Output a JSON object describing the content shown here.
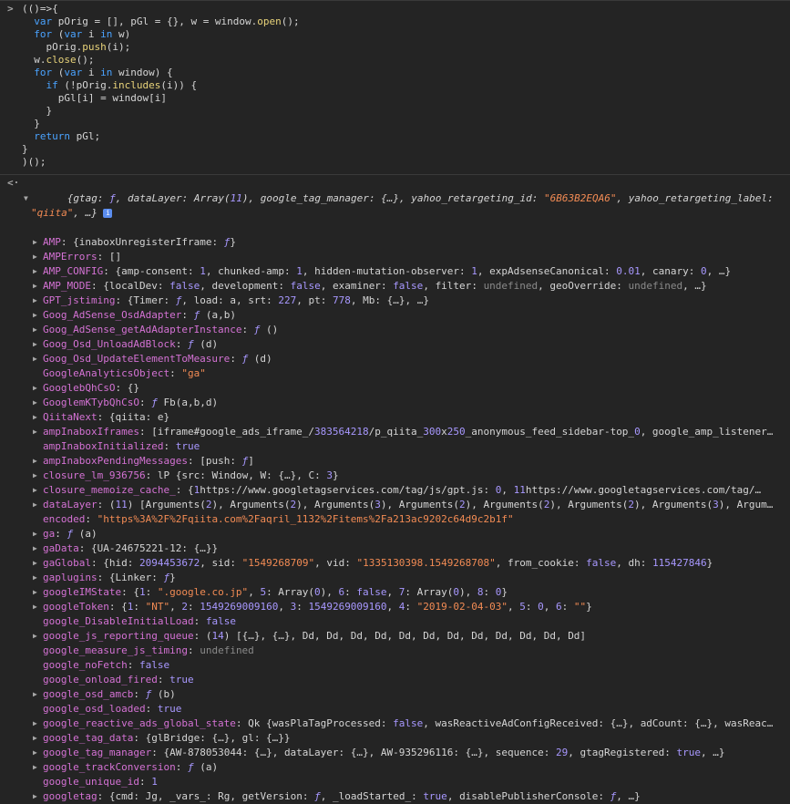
{
  "code_lines": [
    "(()=>{",
    "  var pOrig = [], pGl = {}, w = window.open();",
    "  for (var i in w)",
    "    pOrig.push(i);",
    "  w.close();",
    "  for (var i in window) {",
    "    if (!pOrig.includes(i)) {",
    "      pGl[i] = window[i]",
    "    }",
    "  }",
    "  return pGl;",
    "}",
    ")();"
  ],
  "result_summary": "{gtag: ƒ, dataLayer: Array(11), google_tag_manager: {…}, yahoo_retargeting_id: \"6B63B2EQA6\", yahoo_retargeting_label: \"qiita\", …}",
  "properties": [
    {
      "key": "AMP",
      "value": "{inaboxUnregisterIframe: ƒ}",
      "expandable": true
    },
    {
      "key": "AMPErrors",
      "value": "[]",
      "expandable": true
    },
    {
      "key": "AMP_CONFIG",
      "value": "{amp-consent: 1, chunked-amp: 1, hidden-mutation-observer: 1, expAdsenseCanonical: 0.01, canary: 0, …}",
      "expandable": true
    },
    {
      "key": "AMP_MODE",
      "value": "{localDev: false, development: false, examiner: false, filter: undefined, geoOverride: undefined, …}",
      "expandable": true
    },
    {
      "key": "GPT_jstiming",
      "value": "{Timer: ƒ, load: a, srt: 227, pt: 778, Mb: {…}, …}",
      "expandable": true
    },
    {
      "key": "Goog_AdSense_OsdAdapter",
      "value": "ƒ (a,b)",
      "expandable": true
    },
    {
      "key": "Goog_AdSense_getAdAdapterInstance",
      "value": "ƒ ()",
      "expandable": true
    },
    {
      "key": "Goog_Osd_UnloadAdBlock",
      "value": "ƒ (d)",
      "expandable": true
    },
    {
      "key": "Goog_Osd_UpdateElementToMeasure",
      "value": "ƒ (d)",
      "expandable": true
    },
    {
      "key": "GoogleAnalyticsObject",
      "value": "\"ga\"",
      "expandable": false
    },
    {
      "key": "GooglebQhCsO",
      "value": "{}",
      "expandable": true
    },
    {
      "key": "GooglemKTybQhCsO",
      "value": "ƒ Fb(a,b,d)",
      "expandable": true
    },
    {
      "key": "QiitaNext",
      "value": "{qiita: e}",
      "expandable": true
    },
    {
      "key": "ampInaboxIframes",
      "value": "[iframe#google_ads_iframe_/383564218/p_qiita_300x250_anonymous_feed_sidebar-top_0, google_amp_listener…",
      "expandable": true
    },
    {
      "key": "ampInaboxInitialized",
      "value": "true",
      "expandable": false
    },
    {
      "key": "ampInaboxPendingMessages",
      "value": "[push: ƒ]",
      "expandable": true
    },
    {
      "key": "closure_lm_936756",
      "value": "lP {src: Window, W: {…}, C: 3}",
      "expandable": true
    },
    {
      "key": "closure_memoize_cache_",
      "value": "{1https://www.googletagservices.com/tag/js/gpt.js: 0, 11https://www.googletagservices.com/tag/…",
      "expandable": true
    },
    {
      "key": "dataLayer",
      "value": "(11) [Arguments(2), Arguments(2), Arguments(3), Arguments(2), Arguments(2), Arguments(2), Arguments(3), Argum…",
      "expandable": true
    },
    {
      "key": "encoded",
      "value": "\"https%3A%2F%2Fqiita.com%2Faqril_1132%2Fitems%2Fa213ac9202c64d9c2b1f\"",
      "expandable": false
    },
    {
      "key": "ga",
      "value": "ƒ (a)",
      "expandable": true
    },
    {
      "key": "gaData",
      "value": "{UA-24675221-12: {…}}",
      "expandable": true
    },
    {
      "key": "gaGlobal",
      "value": "{hid: 2094453672, sid: \"1549268709\", vid: \"1335130398.1549268708\", from_cookie: false, dh: 115427846}",
      "expandable": true
    },
    {
      "key": "gaplugins",
      "value": "{Linker: ƒ}",
      "expandable": true
    },
    {
      "key": "googleIMState",
      "value": "{1: \".google.co.jp\", 5: Array(0), 6: false, 7: Array(0), 8: 0}",
      "expandable": true
    },
    {
      "key": "googleToken",
      "value": "{1: \"NT\", 2: 1549269009160, 3: 1549269009160, 4: \"2019-02-04-03\", 5: 0, 6: \"\"}",
      "expandable": true
    },
    {
      "key": "google_DisableInitialLoad",
      "value": "false",
      "expandable": false
    },
    {
      "key": "google_js_reporting_queue",
      "value": "(14) [{…}, {…}, Dd, Dd, Dd, Dd, Dd, Dd, Dd, Dd, Dd, Dd, Dd, Dd]",
      "expandable": true
    },
    {
      "key": "google_measure_js_timing",
      "value": "undefined",
      "expandable": false
    },
    {
      "key": "google_noFetch",
      "value": "false",
      "expandable": false
    },
    {
      "key": "google_onload_fired",
      "value": "true",
      "expandable": false
    },
    {
      "key": "google_osd_amcb",
      "value": "ƒ (b)",
      "expandable": true
    },
    {
      "key": "google_osd_loaded",
      "value": "true",
      "expandable": false
    },
    {
      "key": "google_reactive_ads_global_state",
      "value": "Qk {wasPlaTagProcessed: false, wasReactiveAdConfigReceived: {…}, adCount: {…}, wasReac…",
      "expandable": true
    },
    {
      "key": "google_tag_data",
      "value": "{glBridge: {…}, gl: {…}}",
      "expandable": true
    },
    {
      "key": "google_tag_manager",
      "value": "{AW-878053044: {…}, dataLayer: {…}, AW-935296116: {…}, sequence: 29, gtagRegistered: true, …}",
      "expandable": true
    },
    {
      "key": "google_trackConversion",
      "value": "ƒ (a)",
      "expandable": true
    },
    {
      "key": "google_unique_id",
      "value": "1",
      "expandable": false
    },
    {
      "key": "googletag",
      "value": "{cmd: Jg, _vars_: Rg, getVersion: ƒ, _loadStarted_: true, disablePublisherConsole: ƒ, …}",
      "expandable": true
    }
  ]
}
